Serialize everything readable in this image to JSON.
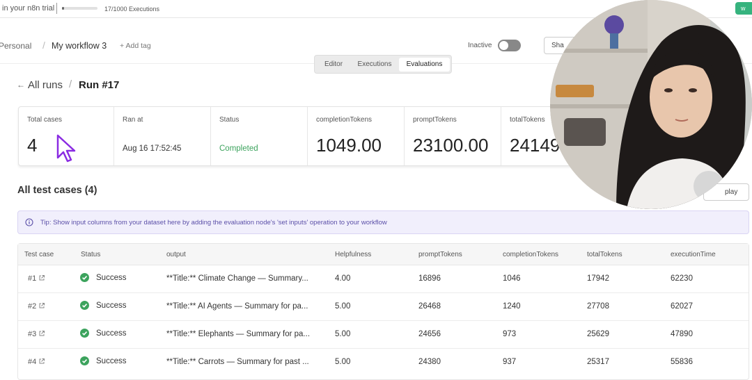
{
  "trial": {
    "text": "in your n8n trial",
    "executions": "17/1000 Executions",
    "progress_fraction": 0.017
  },
  "header": {
    "project": "Personal",
    "workflow": "My workflow 3",
    "add_tag": "+ Add tag",
    "inactive": "Inactive",
    "share": "Sha"
  },
  "tabs": [
    "Editor",
    "Executions",
    "Evaluations"
  ],
  "breadcrumb": {
    "back_arrow": "←",
    "all_runs": "All runs",
    "separator": "/",
    "run": "Run #17"
  },
  "summary": {
    "total_cases_label": "Total cases",
    "total_cases_value": "4",
    "ran_at_label": "Ran at",
    "ran_at_value": "Aug 16 17:52:45",
    "status_label": "Status",
    "status_value": "Completed",
    "completion_tokens_label": "completionTokens",
    "completion_tokens_value": "1049.00",
    "prompt_tokens_label": "promptTokens",
    "prompt_tokens_value": "23100.00",
    "total_tokens_label": "totalTokens",
    "total_tokens_value": "24149."
  },
  "section": {
    "title": "All test cases (4)",
    "display_button": "play"
  },
  "tip": {
    "text": "Tip: Show input columns from your dataset here by adding the evaluation node's 'set inputs' operation to your workflow"
  },
  "table": {
    "headers": [
      "Test case",
      "Status",
      "output",
      "Helpfulness",
      "promptTokens",
      "completionTokens",
      "totalTokens",
      "executionTime"
    ],
    "rows": [
      {
        "case": "#1",
        "status": "Success",
        "output": "**Title:** Climate Change — Summary...",
        "helpfulness": "4.00",
        "prompt": "16896",
        "completion": "1046",
        "total": "17942",
        "time": "62230"
      },
      {
        "case": "#2",
        "status": "Success",
        "output": "**Title:** AI Agents — Summary for pa...",
        "helpfulness": "5.00",
        "prompt": "26468",
        "completion": "1240",
        "total": "27708",
        "time": "62027"
      },
      {
        "case": "#3",
        "status": "Success",
        "output": "**Title:** Elephants — Summary for pa...",
        "helpfulness": "5.00",
        "prompt": "24656",
        "completion": "973",
        "total": "25629",
        "time": "47890"
      },
      {
        "case": "#4",
        "status": "Success",
        "output": "**Title:** Carrots — Summary for past ...",
        "helpfulness": "5.00",
        "prompt": "24380",
        "completion": "937",
        "total": "25317",
        "time": "55836"
      }
    ]
  },
  "colors": {
    "success": "#3ca35d",
    "tip_bg": "#f1effc",
    "tip_text": "#5b4fa8",
    "cursor": "#8a2be2"
  }
}
